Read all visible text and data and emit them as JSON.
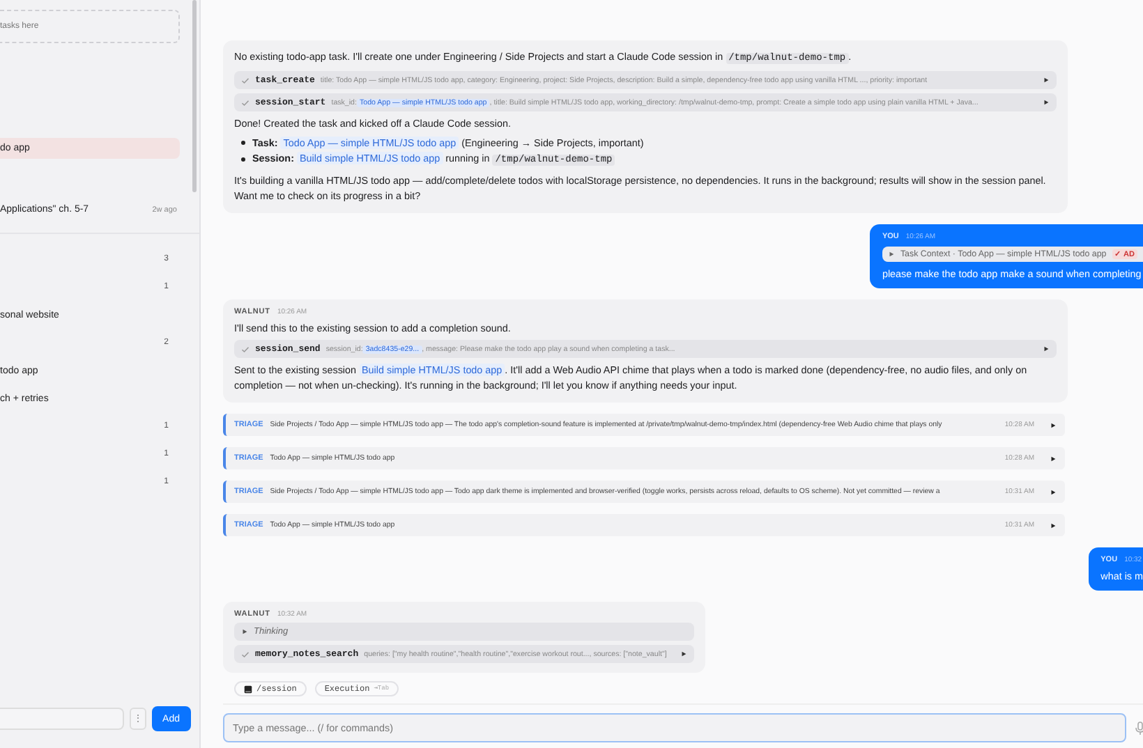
{
  "sidebar": {
    "top_items": [
      {
        "kind": "dropzone",
        "text": "tasks here"
      },
      {
        "kind": "task",
        "text": "do app",
        "selected": true
      },
      {
        "kind": "task",
        "text": "Applications\" ch. 5-7",
        "meta": "2w ago",
        "selected": false
      }
    ],
    "groups": [
      {
        "kind": "count",
        "text": "3"
      },
      {
        "kind": "count",
        "text": "1"
      },
      {
        "kind": "task",
        "text": "sonal website"
      },
      {
        "kind": "count",
        "text": "2"
      },
      {
        "kind": "task",
        "text": "todo app"
      },
      {
        "kind": "task",
        "text": "ch + retries"
      },
      {
        "kind": "count",
        "text": "1"
      },
      {
        "kind": "count",
        "text": "1"
      },
      {
        "kind": "count",
        "text": "1"
      }
    ],
    "more_button": "⋮",
    "add_button": "Add"
  },
  "messages": [
    {
      "kind": "assistant",
      "blocks": [
        {
          "kind": "para",
          "parts": [
            {
              "kind": "text",
              "text": "No existing todo-app task. I'll create one under Engineering / Side Projects and start a Claude Code session in "
            },
            {
              "kind": "code",
              "text": "/tmp/walnut-demo-tmp"
            },
            {
              "kind": "text",
              "text": "."
            }
          ]
        },
        {
          "kind": "tool",
          "name": "task_create",
          "parts": [
            {
              "kind": "text",
              "text": "title: Todo App — simple HTML/JS todo app, category: Engineering, project: Side Projects, description: Build a simple, dependency-free todo app using vanilla HTML ..., priority: important"
            }
          ]
        },
        {
          "kind": "tool",
          "name": "session_start",
          "parts": [
            {
              "kind": "text",
              "text": "task_id:"
            },
            {
              "kind": "chip",
              "text": "Todo App — simple HTML/JS todo app"
            },
            {
              "kind": "text",
              "text": ", title: Build simple HTML/JS todo app, working_directory: /tmp/walnut-demo-tmp, prompt: Create a simple todo app using plain vanilla HTML + Java..."
            }
          ]
        },
        {
          "kind": "para",
          "parts": [
            {
              "kind": "text",
              "text": "Done! Created the task and kicked off a Claude Code session."
            }
          ]
        },
        {
          "kind": "list",
          "items": [
            [
              {
                "kind": "text",
                "text": "**Task:**"
              },
              {
                "kind": "link",
                "text": "Todo App — simple HTML/JS todo app"
              },
              {
                "kind": "text",
                "text": "(Engineering → Side Projects, important)"
              }
            ],
            [
              {
                "kind": "text",
                "text": "**Session:**"
              },
              {
                "kind": "link",
                "text": "Build simple HTML/JS todo app"
              },
              {
                "kind": "text",
                "text": "running in"
              },
              {
                "kind": "code",
                "text": "/tmp/walnut-demo-tmp"
              }
            ]
          ]
        },
        {
          "kind": "para",
          "parts": [
            {
              "kind": "text",
              "text": "It's building a vanilla HTML/JS todo app — add/complete/delete todos with localStorage persistence, no dependencies. It runs in the background; results will show in the session panel. Want me to check on its progress in a bit?"
            }
          ]
        }
      ]
    },
    {
      "kind": "user",
      "author": "YOU",
      "time": "10:26 AM",
      "context": "Task Context · Todo App — simple HTML/JS todo app",
      "badge": "✓ AD",
      "text": "please make the todo app make a sound when completing"
    },
    {
      "kind": "assistant",
      "author": "WALNUT",
      "time": "10:26 AM",
      "blocks": [
        {
          "kind": "para",
          "parts": [
            {
              "kind": "text",
              "text": "I'll send this to the existing session to add a completion sound."
            }
          ]
        },
        {
          "kind": "tool",
          "name": "session_send",
          "parts": [
            {
              "kind": "text",
              "text": "session_id:"
            },
            {
              "kind": "chip",
              "text": "3adc8435-e29..."
            },
            {
              "kind": "text",
              "text": ", message: Please make the todo app play a sound when completing a task..."
            }
          ]
        },
        {
          "kind": "para",
          "parts": [
            {
              "kind": "text",
              "text": "Sent to the existing session "
            },
            {
              "kind": "link",
              "text": "Build simple HTML/JS todo app"
            },
            {
              "kind": "text",
              "text": ". It'll add a Web Audio API chime that plays when a todo is marked done (dependency-free, no audio files, and only on completion — not when un-checking). It's running in the background; I'll let you know if anything needs your input."
            }
          ]
        }
      ]
    },
    {
      "kind": "triage",
      "label": "TRIAGE",
      "text": "Side Projects / Todo App — simple HTML/JS todo app — The todo app's completion-sound feature is implemented at /private/tmp/walnut-demo-tmp/index.html (dependency-free Web Audio chime that plays only",
      "time": "10:28 AM"
    },
    {
      "kind": "triage",
      "label": "TRIAGE",
      "text": "Todo App — simple HTML/JS todo app",
      "time": "10:28 AM"
    },
    {
      "kind": "triage",
      "label": "TRIAGE",
      "text": "Side Projects / Todo App — simple HTML/JS todo app — Todo app dark theme is implemented and browser-verified (toggle works, persists across reload, defaults to OS scheme). Not yet committed — review a",
      "time": "10:31 AM"
    },
    {
      "kind": "triage",
      "label": "TRIAGE",
      "text": "Todo App — simple HTML/JS todo app",
      "time": "10:31 AM"
    },
    {
      "kind": "user",
      "author": "YOU",
      "time": "10:32",
      "text": "what is m"
    },
    {
      "kind": "assistant",
      "author": "WALNUT",
      "time": "10:32 AM",
      "blocks": [
        {
          "kind": "thinking",
          "text": "Thinking"
        },
        {
          "kind": "tool",
          "name": "memory_notes_search",
          "parts": [
            {
              "kind": "text",
              "text": "queries: [\"my health routine\",\"health routine\",\"exercise workout rout..., sources: [\"note_vault\"]"
            }
          ]
        }
      ]
    }
  ],
  "chips": [
    {
      "kind": "command",
      "text": "/session"
    },
    {
      "kind": "mode",
      "text": "Execution",
      "hint": "⇥Tab"
    }
  ],
  "composer": {
    "placeholder": "Type a message... (/ for commands)"
  }
}
